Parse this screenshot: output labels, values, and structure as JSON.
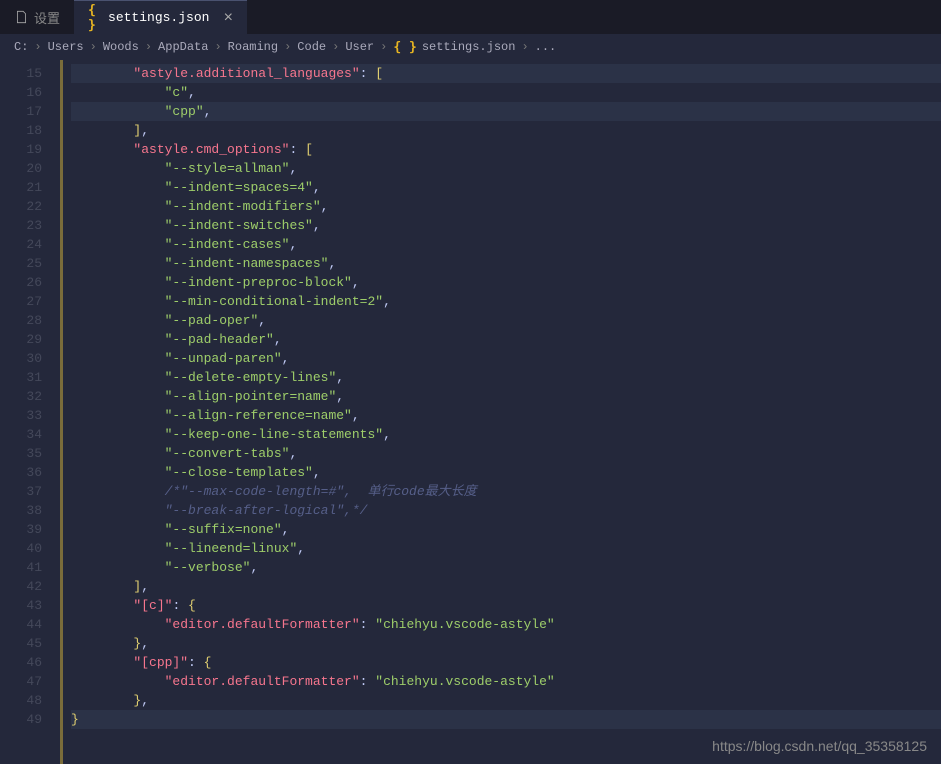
{
  "tabs": {
    "inactive": {
      "label": "设置"
    },
    "active": {
      "label": "settings.json"
    }
  },
  "breadcrumb": {
    "parts": [
      "C:",
      "Users",
      "Woods",
      "AppData",
      "Roaming",
      "Code",
      "User",
      "settings.json",
      "..."
    ]
  },
  "watermark": "https://blog.csdn.net/qq_35358125",
  "lines": [
    {
      "num": 15,
      "tokens": [
        {
          "t": "        ",
          "c": ""
        },
        {
          "t": "\"astyle.additional_languages\"",
          "c": "key"
        },
        {
          "t": ": ",
          "c": "punc"
        },
        {
          "t": "[",
          "c": "brack"
        }
      ],
      "indent": 2,
      "hl": true
    },
    {
      "num": 16,
      "tokens": [
        {
          "t": "            ",
          "c": ""
        },
        {
          "t": "\"c\"",
          "c": "str"
        },
        {
          "t": ",",
          "c": "punc"
        }
      ],
      "indent": 3
    },
    {
      "num": 17,
      "tokens": [
        {
          "t": "            ",
          "c": ""
        },
        {
          "t": "\"cpp\"",
          "c": "str"
        },
        {
          "t": ",",
          "c": "punc"
        }
      ],
      "indent": 3,
      "hl": true
    },
    {
      "num": 18,
      "tokens": [
        {
          "t": "        ",
          "c": ""
        },
        {
          "t": "]",
          "c": "brack"
        },
        {
          "t": ",",
          "c": "punc"
        }
      ],
      "indent": 2
    },
    {
      "num": 19,
      "tokens": [
        {
          "t": "        ",
          "c": ""
        },
        {
          "t": "\"astyle.cmd_options\"",
          "c": "key"
        },
        {
          "t": ": ",
          "c": "punc"
        },
        {
          "t": "[",
          "c": "brack"
        }
      ],
      "indent": 2
    },
    {
      "num": 20,
      "tokens": [
        {
          "t": "            ",
          "c": ""
        },
        {
          "t": "\"--style=allman\"",
          "c": "str"
        },
        {
          "t": ",",
          "c": "punc"
        }
      ],
      "indent": 3
    },
    {
      "num": 21,
      "tokens": [
        {
          "t": "            ",
          "c": ""
        },
        {
          "t": "\"--indent=spaces=4\"",
          "c": "str"
        },
        {
          "t": ",",
          "c": "punc"
        }
      ],
      "indent": 3
    },
    {
      "num": 22,
      "tokens": [
        {
          "t": "            ",
          "c": ""
        },
        {
          "t": "\"--indent-modifiers\"",
          "c": "str"
        },
        {
          "t": ",",
          "c": "punc"
        }
      ],
      "indent": 3
    },
    {
      "num": 23,
      "tokens": [
        {
          "t": "            ",
          "c": ""
        },
        {
          "t": "\"--indent-switches\"",
          "c": "str"
        },
        {
          "t": ",",
          "c": "punc"
        }
      ],
      "indent": 3
    },
    {
      "num": 24,
      "tokens": [
        {
          "t": "            ",
          "c": ""
        },
        {
          "t": "\"--indent-cases\"",
          "c": "str"
        },
        {
          "t": ",",
          "c": "punc"
        }
      ],
      "indent": 3
    },
    {
      "num": 25,
      "tokens": [
        {
          "t": "            ",
          "c": ""
        },
        {
          "t": "\"--indent-namespaces\"",
          "c": "str"
        },
        {
          "t": ",",
          "c": "punc"
        }
      ],
      "indent": 3
    },
    {
      "num": 26,
      "tokens": [
        {
          "t": "            ",
          "c": ""
        },
        {
          "t": "\"--indent-preproc-block\"",
          "c": "str"
        },
        {
          "t": ",",
          "c": "punc"
        }
      ],
      "indent": 3
    },
    {
      "num": 27,
      "tokens": [
        {
          "t": "            ",
          "c": ""
        },
        {
          "t": "\"--min-conditional-indent=2\"",
          "c": "str"
        },
        {
          "t": ",",
          "c": "punc"
        }
      ],
      "indent": 3
    },
    {
      "num": 28,
      "tokens": [
        {
          "t": "            ",
          "c": ""
        },
        {
          "t": "\"--pad-oper\"",
          "c": "str"
        },
        {
          "t": ",",
          "c": "punc"
        }
      ],
      "indent": 3
    },
    {
      "num": 29,
      "tokens": [
        {
          "t": "            ",
          "c": ""
        },
        {
          "t": "\"--pad-header\"",
          "c": "str"
        },
        {
          "t": ",",
          "c": "punc"
        }
      ],
      "indent": 3
    },
    {
      "num": 30,
      "tokens": [
        {
          "t": "            ",
          "c": ""
        },
        {
          "t": "\"--unpad-paren\"",
          "c": "str"
        },
        {
          "t": ",",
          "c": "punc"
        }
      ],
      "indent": 3
    },
    {
      "num": 31,
      "tokens": [
        {
          "t": "            ",
          "c": ""
        },
        {
          "t": "\"--delete-empty-lines\"",
          "c": "str"
        },
        {
          "t": ",",
          "c": "punc"
        }
      ],
      "indent": 3
    },
    {
      "num": 32,
      "tokens": [
        {
          "t": "            ",
          "c": ""
        },
        {
          "t": "\"--align-pointer=name\"",
          "c": "str"
        },
        {
          "t": ",",
          "c": "punc"
        }
      ],
      "indent": 3
    },
    {
      "num": 33,
      "tokens": [
        {
          "t": "            ",
          "c": ""
        },
        {
          "t": "\"--align-reference=name\"",
          "c": "str"
        },
        {
          "t": ",",
          "c": "punc"
        }
      ],
      "indent": 3
    },
    {
      "num": 34,
      "tokens": [
        {
          "t": "            ",
          "c": ""
        },
        {
          "t": "\"--keep-one-line-statements\"",
          "c": "str"
        },
        {
          "t": ",",
          "c": "punc"
        }
      ],
      "indent": 3
    },
    {
      "num": 35,
      "tokens": [
        {
          "t": "            ",
          "c": ""
        },
        {
          "t": "\"--convert-tabs\"",
          "c": "str"
        },
        {
          "t": ",",
          "c": "punc"
        }
      ],
      "indent": 3
    },
    {
      "num": 36,
      "tokens": [
        {
          "t": "            ",
          "c": ""
        },
        {
          "t": "\"--close-templates\"",
          "c": "str"
        },
        {
          "t": ",",
          "c": "punc"
        }
      ],
      "indent": 3
    },
    {
      "num": 37,
      "tokens": [
        {
          "t": "            ",
          "c": ""
        },
        {
          "t": "/*\"--max-code-length=#\",  单行code最大长度",
          "c": "cmt"
        }
      ],
      "indent": 3
    },
    {
      "num": 38,
      "tokens": [
        {
          "t": "            ",
          "c": ""
        },
        {
          "t": "\"--break-after-logical\",*/",
          "c": "cmt"
        }
      ],
      "indent": 3
    },
    {
      "num": 39,
      "tokens": [
        {
          "t": "            ",
          "c": ""
        },
        {
          "t": "\"--suffix=none\"",
          "c": "str"
        },
        {
          "t": ",",
          "c": "punc"
        }
      ],
      "indent": 3
    },
    {
      "num": 40,
      "tokens": [
        {
          "t": "            ",
          "c": ""
        },
        {
          "t": "\"--lineend=linux\"",
          "c": "str"
        },
        {
          "t": ",",
          "c": "punc"
        }
      ],
      "indent": 3
    },
    {
      "num": 41,
      "tokens": [
        {
          "t": "            ",
          "c": ""
        },
        {
          "t": "\"--verbose\"",
          "c": "str"
        },
        {
          "t": ",",
          "c": "punc"
        }
      ],
      "indent": 3
    },
    {
      "num": 42,
      "tokens": [
        {
          "t": "        ",
          "c": ""
        },
        {
          "t": "]",
          "c": "brack"
        },
        {
          "t": ",",
          "c": "punc"
        }
      ],
      "indent": 2
    },
    {
      "num": 43,
      "tokens": [
        {
          "t": "        ",
          "c": ""
        },
        {
          "t": "\"[c]\"",
          "c": "key"
        },
        {
          "t": ": ",
          "c": "punc"
        },
        {
          "t": "{",
          "c": "brack"
        }
      ],
      "indent": 2
    },
    {
      "num": 44,
      "tokens": [
        {
          "t": "            ",
          "c": ""
        },
        {
          "t": "\"editor.defaultFormatter\"",
          "c": "key"
        },
        {
          "t": ": ",
          "c": "punc"
        },
        {
          "t": "\"chiehyu.vscode-astyle\"",
          "c": "str"
        }
      ],
      "indent": 3
    },
    {
      "num": 45,
      "tokens": [
        {
          "t": "        ",
          "c": ""
        },
        {
          "t": "}",
          "c": "brack"
        },
        {
          "t": ",",
          "c": "punc"
        }
      ],
      "indent": 2
    },
    {
      "num": 46,
      "tokens": [
        {
          "t": "        ",
          "c": ""
        },
        {
          "t": "\"[cpp]\"",
          "c": "key"
        },
        {
          "t": ": ",
          "c": "punc"
        },
        {
          "t": "{",
          "c": "brack"
        }
      ],
      "indent": 2
    },
    {
      "num": 47,
      "tokens": [
        {
          "t": "            ",
          "c": ""
        },
        {
          "t": "\"editor.defaultFormatter\"",
          "c": "key"
        },
        {
          "t": ": ",
          "c": "punc"
        },
        {
          "t": "\"chiehyu.vscode-astyle\"",
          "c": "str"
        }
      ],
      "indent": 3
    },
    {
      "num": 48,
      "tokens": [
        {
          "t": "        ",
          "c": ""
        },
        {
          "t": "}",
          "c": "brack"
        },
        {
          "t": ",",
          "c": "punc"
        }
      ],
      "indent": 2
    },
    {
      "num": 49,
      "tokens": [
        {
          "t": "}",
          "c": "brack"
        }
      ],
      "indent": 0,
      "hl": true
    }
  ]
}
